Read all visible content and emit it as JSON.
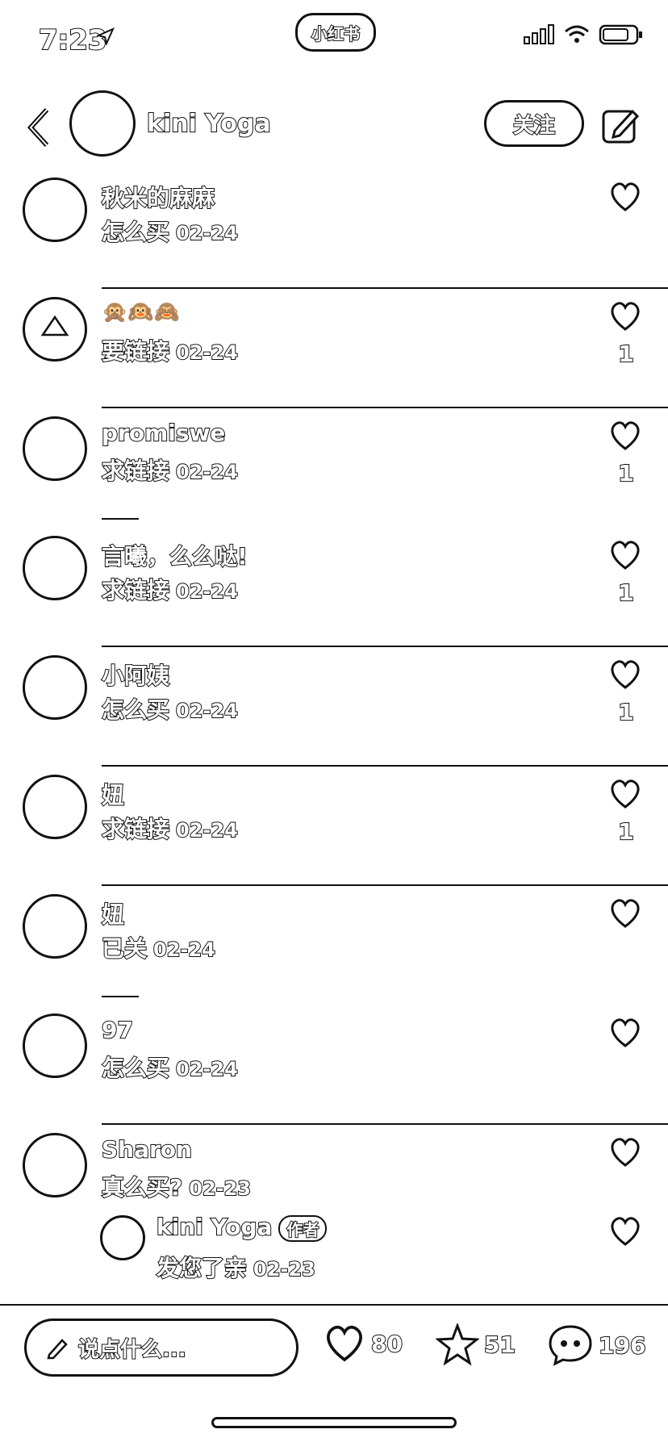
{
  "status_bar": {
    "time": "7:23",
    "island_label": "小红书"
  },
  "header": {
    "author": "kini Yoga",
    "follow_label": "关注"
  },
  "comments": [
    {
      "name": "秋米的麻麻",
      "text": "怎么买",
      "date": "02-24",
      "likes": ""
    },
    {
      "name": "🙊🙉🙈",
      "text": "要链接",
      "date": "02-24",
      "likes": "1"
    },
    {
      "name": "promiswe",
      "text": "求链接",
      "date": "02-24",
      "likes": "1"
    },
    {
      "name": "言曦，么么哒!",
      "text": "求链接",
      "date": "02-24",
      "likes": "1"
    },
    {
      "name": "小阿姨",
      "text": "怎么买",
      "date": "02-24",
      "likes": "1"
    },
    {
      "name": "妞",
      "text": "求链接",
      "date": "02-24",
      "likes": "1"
    },
    {
      "name": "妞",
      "text": "已关",
      "date": "02-24",
      "likes": ""
    },
    {
      "name": "97",
      "text": "怎么买",
      "date": "02-24",
      "likes": ""
    },
    {
      "name": "Sharon",
      "text": "真么买?",
      "date": "02-23",
      "likes": ""
    }
  ],
  "reply": {
    "name": "kini Yoga",
    "tag": "作者",
    "text": "发您了亲",
    "date": "02-23"
  },
  "bottom_bar": {
    "input_placeholder": "说点什么...",
    "likes": "80",
    "stars": "51",
    "comments": "196"
  },
  "icons": [
    "back-icon",
    "edit-icon",
    "heart-icon",
    "star-icon",
    "comment-icon",
    "pencil-icon",
    "signal-icon",
    "wifi-icon",
    "battery-icon",
    "location-icon"
  ]
}
